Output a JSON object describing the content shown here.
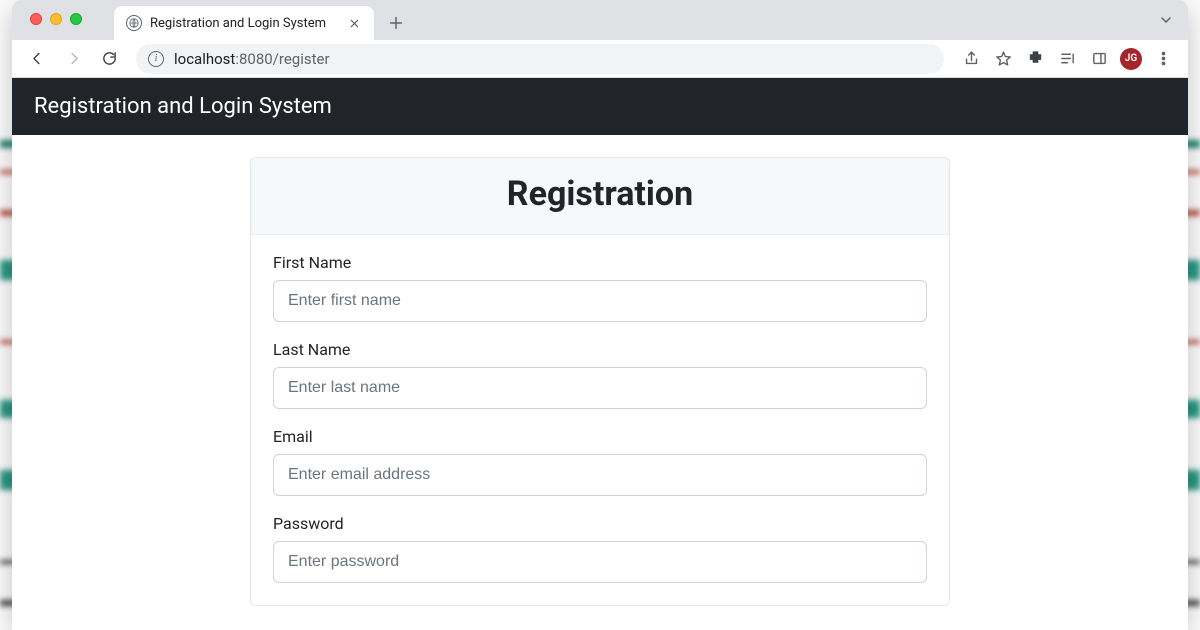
{
  "browser": {
    "tab": {
      "title": "Registration and Login System",
      "url_host": "localhost",
      "url_port_path": ":8080/register"
    },
    "avatar_initials": "JG"
  },
  "page": {
    "app_title": "Registration and Login System",
    "card_title": "Registration",
    "fields": {
      "first_name": {
        "label": "First Name",
        "placeholder": "Enter first name"
      },
      "last_name": {
        "label": "Last Name",
        "placeholder": "Enter last name"
      },
      "email": {
        "label": "Email",
        "placeholder": "Enter email address"
      },
      "password": {
        "label": "Password",
        "placeholder": "Enter password"
      }
    }
  }
}
